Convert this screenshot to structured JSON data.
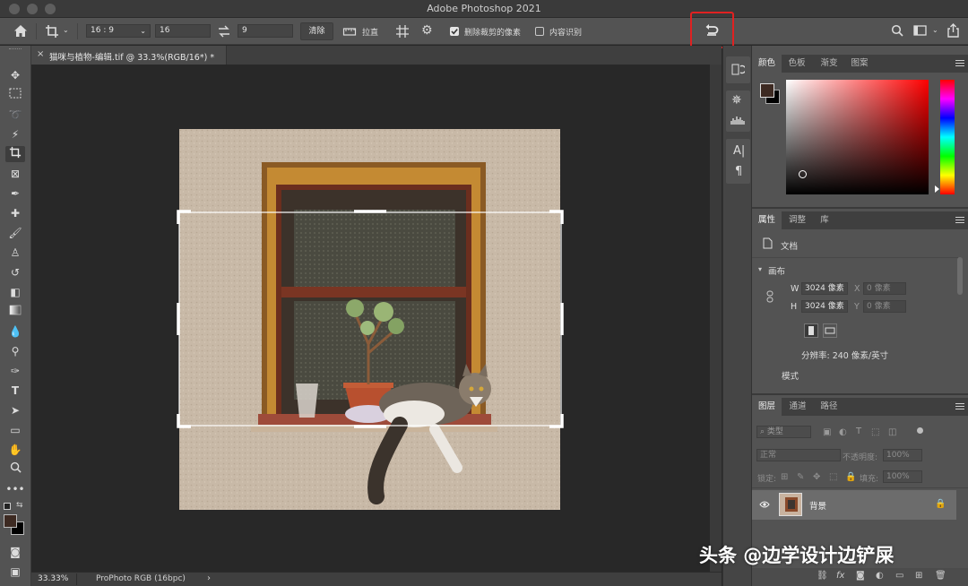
{
  "app": {
    "title": "Adobe Photoshop 2021"
  },
  "options_bar": {
    "ratio_value": "16 : 9",
    "width_value": "16",
    "height_value": "9",
    "clear_label": "清除",
    "straighten_label": "拉直",
    "delete_cropped_label": "删除裁剪的像素",
    "delete_cropped_checked": true,
    "content_aware_label": "内容识别",
    "content_aware_checked": false
  },
  "document": {
    "tab_title": "猫咪与植物-编辑.tif @ 33.3%(RGB/16*) *",
    "zoom": "33.33%",
    "color_profile": "ProPhoto RGB (16bpc)",
    "status_arrow": "›"
  },
  "color_panel": {
    "tabs": [
      "颜色",
      "色板",
      "渐变",
      "图案"
    ],
    "active_tab": "颜色",
    "foreground": "#3d2a22",
    "background": "#000000",
    "hue_color": "#ff0000"
  },
  "properties_panel": {
    "tabs": [
      "属性",
      "调整",
      "库"
    ],
    "active_tab": "属性",
    "doc_label": "文档",
    "section_title": "画布",
    "w_label": "W",
    "w_value": "3024 像素",
    "h_label": "H",
    "h_value": "3024 像素",
    "x_label": "X",
    "x_placeholder": "0 像素",
    "y_label": "Y",
    "y_placeholder": "0 像素",
    "resolution": "分辨率: 240 像素/英寸",
    "mode_label": "模式"
  },
  "layers_panel": {
    "tabs": [
      "图层",
      "通道",
      "路径"
    ],
    "active_tab": "图层",
    "filter_label": "类型",
    "blend_mode": "正常",
    "opacity_label": "不透明度:",
    "opacity_value": "100%",
    "lock_label": "锁定:",
    "fill_label": "填充:",
    "fill_value": "100%",
    "layers": [
      {
        "name": "背景",
        "visible": true,
        "locked": true
      }
    ]
  },
  "watermark": "头条 @边学设计边铲屎"
}
